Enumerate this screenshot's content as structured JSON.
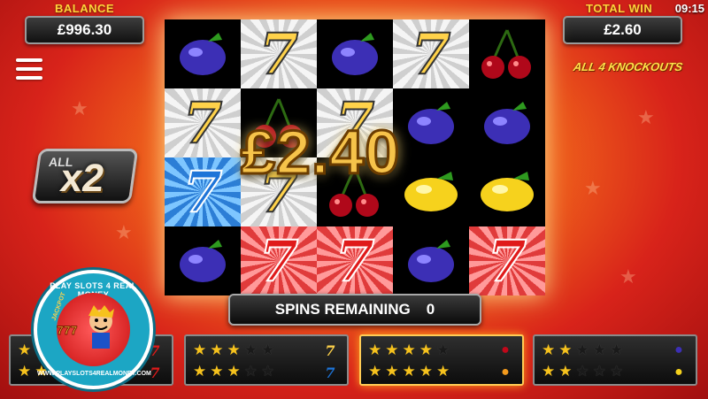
{
  "header": {
    "balance_label": "BALANCE",
    "balance_value": "£996.30",
    "total_win_label": "TOTAL WIN",
    "total_win_value": "£2.60",
    "clock": "09:15"
  },
  "logo_text": "ALL 4 KNOCKOUTS",
  "multiplier": {
    "label": "ALL",
    "value": "x2"
  },
  "win_amount": "£2.40",
  "spins": {
    "label": "SPINS REMAINING",
    "value": "0"
  },
  "reels": [
    [
      "plum",
      "seven-gold",
      "seven-blue",
      "plum"
    ],
    [
      "seven-gold",
      "cherry",
      "seven-gold",
      "seven-red"
    ],
    [
      "plum",
      "seven-gold",
      "cherry",
      "seven-red"
    ],
    [
      "seven-gold",
      "plum",
      "lemon",
      "plum"
    ],
    [
      "cherry",
      "plum",
      "lemon",
      "seven-red"
    ]
  ],
  "bottom_panels": [
    {
      "stars_row1": 2,
      "stars_row2": 2,
      "icon1": "seven-red",
      "icon2": "seven-red",
      "active": false
    },
    {
      "stars_row1": 3,
      "stars_row2": 3,
      "icon1": "seven-gold",
      "icon2": "seven-blue",
      "active": false
    },
    {
      "stars_row1": 4,
      "stars_row2": 5,
      "icon1": "cherry",
      "icon2": "orange",
      "active": true
    },
    {
      "stars_row1": 2,
      "stars_row2": 2,
      "icon1": "plum",
      "icon2": "lemon",
      "active": false
    }
  ],
  "badge": {
    "top_text": "PLAY SLOTS 4 REAL MONEY",
    "bottom_text": "WWW.PLAYSLOTS4REALMONEY.COM",
    "jackpot": "JACKPOT",
    "sevens": "777"
  },
  "colors": {
    "gold": "#f6c21d",
    "panel": "#111111",
    "reel_bg": "#000000"
  }
}
